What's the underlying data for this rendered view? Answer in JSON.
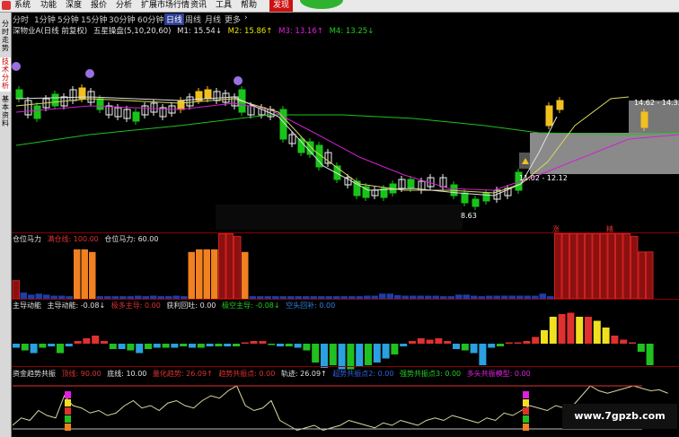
{
  "menu": {
    "items": [
      "系统",
      "功能",
      "报价",
      "分析",
      "扩展市场行情",
      "资讯",
      "工具",
      "帮助"
    ],
    "hot_label": "发现",
    "items_extra": [
      "深度"
    ]
  },
  "sidebar": {
    "tabs": [
      "分时走势",
      "技术分析",
      "基本资料"
    ],
    "active_index": 1
  },
  "periods": [
    "分时",
    "1分钟",
    "5分钟",
    "15分钟",
    "30分钟",
    "60分钟",
    "日线",
    "周线",
    "月线",
    "更多",
    "›"
  ],
  "period_selected": "日线",
  "main": {
    "title": "深物业A(日线 前复权)",
    "indicator": "五星操盘(5,10,20,60)",
    "ma": [
      {
        "label": "M1: 15.54↓",
        "color": "#e0e0e0"
      },
      {
        "label": "M2: 15.86↑",
        "color": "#e6e600"
      },
      {
        "label": "M3: 13.16↑",
        "color": "#e020e0"
      },
      {
        "label": "M4: 13.25↓",
        "color": "#20d020"
      }
    ],
    "annotations": {
      "low_price": "8.63",
      "range_label": "11.02 - 12.12",
      "range_label_top": "14.62 - 14.33",
      "tag1": "涨",
      "tag2": "精"
    },
    "colors": {
      "up": "#f0f0f0",
      "down": "#18c418",
      "gold": "#f0c020",
      "red": "#e03030"
    }
  },
  "indicator1": {
    "title": "仓位马力",
    "items": [
      {
        "label": "满仓线: 100.00",
        "color": "#e03030"
      },
      {
        "label": "仓位马力: 60.00",
        "color": "#e0e0e0"
      }
    ],
    "bars": [
      0.35,
      0.12,
      0.08,
      0.1,
      0.08,
      0.06,
      0.06,
      0.05,
      0.95,
      0.95,
      0.9,
      0.05,
      0.05,
      0.05,
      0.05,
      0.05,
      0.06,
      0.05,
      0.06,
      0.05,
      0.05,
      0.06,
      0.05,
      0.9,
      0.95,
      0.95,
      0.95,
      1.3,
      1.3,
      1.2,
      0.9,
      0.05,
      0.05,
      0.05,
      0.05,
      0.05,
      0.05,
      0.05,
      0.05,
      0.05,
      0.05,
      0.05,
      0.05,
      0.05,
      0.05,
      0.05,
      0.06,
      0.06,
      0.1,
      0.1,
      0.07,
      0.06,
      0.06,
      0.06,
      0.06,
      0.06,
      0.05,
      0.05,
      0.08,
      0.08,
      0.06,
      0.05,
      0.06,
      0.06,
      0.06,
      0.06,
      0.06,
      0.06,
      0.06,
      0.1,
      0.05,
      1.3,
      1.3,
      1.3,
      1.3,
      1.3,
      1.3,
      1.3,
      1.3,
      1.3,
      1.3,
      1.2,
      0.9,
      0.9
    ]
  },
  "indicator2": {
    "title": "主导动能",
    "items": [
      {
        "label": "主导动能: -0.08↓",
        "color": "#e0e0e0"
      },
      {
        "label": "极多主导: 0.00",
        "color": "#e03030"
      },
      {
        "label": "获利回吐: 0.00",
        "color": "#e0e0e0"
      },
      {
        "label": "极空主导: -0.08↓",
        "color": "#20d020"
      },
      {
        "label": "空头回补: 0.00",
        "color": "#3080e0"
      }
    ],
    "bars": [
      -0.15,
      -0.25,
      -0.35,
      -0.15,
      -0.1,
      -0.35,
      -0.1,
      0.1,
      0.2,
      0.3,
      0.1,
      -0.2,
      -0.2,
      -0.25,
      -0.35,
      -0.2,
      -0.15,
      -0.15,
      -0.15,
      -0.1,
      -0.15,
      -0.15,
      -0.1,
      -0.1,
      -0.1,
      -0.1,
      0.05,
      0.1,
      0.1,
      -0.05,
      -0.1,
      -0.1,
      -0.15,
      -0.25,
      -0.7,
      -0.9,
      -0.8,
      -0.95,
      -0.95,
      -0.85,
      -0.8,
      -0.7,
      -0.55,
      -0.4,
      -0.1,
      0.1,
      0.2,
      0.15,
      0.2,
      0.1,
      -0.2,
      -0.25,
      -0.35,
      -0.8,
      -0.15,
      -0.1,
      0.05,
      0.05,
      0.1,
      0.25,
      0.5,
      1.0,
      1.1,
      1.15,
      1.0,
      1.0,
      0.85,
      0.6,
      0.3,
      0.15,
      0.05,
      -0.3,
      -0.8
    ]
  },
  "indicator3": {
    "title": "资金趋势共振",
    "items": [
      {
        "label": "顶线: 90.00",
        "color": "#e03030"
      },
      {
        "label": "底线: 10.00",
        "color": "#e0e0e0"
      },
      {
        "label": "量化趋势: 26.09↑",
        "color": "#e03030"
      },
      {
        "label": "趋势共振点: 0.00",
        "color": "#e03030"
      },
      {
        "label": "轨迹: 26.09↑",
        "color": "#e0e0e0"
      },
      {
        "label": "超势共振点2: 0.00",
        "color": "#3060e0"
      },
      {
        "label": "强势共振点3: 0.00",
        "color": "#20d020"
      },
      {
        "label": "多头共振模型: 0.00",
        "color": "#e020e0"
      }
    ],
    "line": [
      0.2,
      0.35,
      0.3,
      0.5,
      0.4,
      0.35,
      0.8,
      0.6,
      0.55,
      0.45,
      0.5,
      0.4,
      0.45,
      0.6,
      0.7,
      0.55,
      0.6,
      0.5,
      0.65,
      0.7,
      0.6,
      0.55,
      0.7,
      0.8,
      0.75,
      0.9,
      1.0,
      0.6,
      0.5,
      0.55,
      0.7,
      0.3,
      0.2,
      0.1,
      0.15,
      0.2,
      0.1,
      0.15,
      0.2,
      0.3,
      0.25,
      0.2,
      0.15,
      0.25,
      0.2,
      0.3,
      0.25,
      0.2,
      0.3,
      0.35,
      0.3,
      0.4,
      0.35,
      0.3,
      0.25,
      0.35,
      0.3,
      0.45,
      0.4,
      0.5,
      0.6,
      0.55,
      0.5,
      0.6,
      0.55,
      0.6,
      0.8,
      1.0,
      0.9,
      0.85,
      0.9,
      0.95,
      1.0,
      0.95,
      0.9,
      0.92,
      0.85
    ]
  },
  "watermark": "www.7gpzb.com"
}
